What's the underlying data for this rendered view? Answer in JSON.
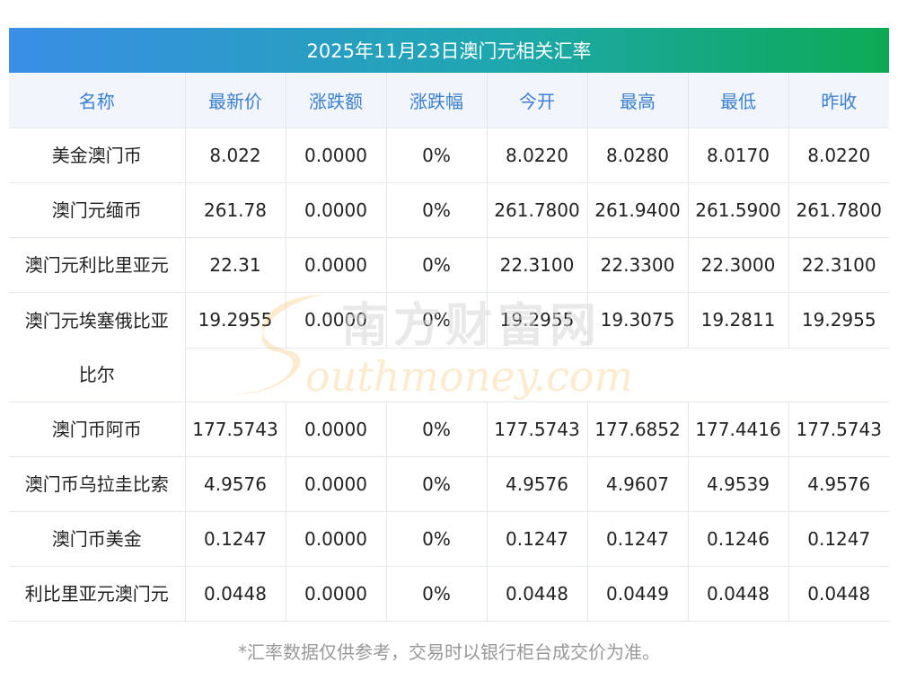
{
  "title": "2025年11月23日澳门元相关汇率",
  "columns": [
    "名称",
    "最新价",
    "涨跌额",
    "涨跌幅",
    "今开",
    "最高",
    "最低",
    "昨收"
  ],
  "rows": [
    [
      "美金澳门币",
      "8.022",
      "0.0000",
      "0%",
      "8.0220",
      "8.0280",
      "8.0170",
      "8.0220"
    ],
    [
      "澳门元缅币",
      "261.78",
      "0.0000",
      "0%",
      "261.7800",
      "261.9400",
      "261.5900",
      "261.7800"
    ],
    [
      "澳门元利比里亚元",
      "22.31",
      "0.0000",
      "0%",
      "22.3100",
      "22.3300",
      "22.3000",
      "22.3100"
    ],
    [
      "澳门元埃塞俄比亚比尔",
      "19.2955",
      "0.0000",
      "0%",
      "19.2955",
      "19.3075",
      "19.2811",
      "19.2955"
    ],
    [
      "澳门币阿币",
      "177.5743",
      "0.0000",
      "0%",
      "177.5743",
      "177.6852",
      "177.4416",
      "177.5743"
    ],
    [
      "澳门币乌拉圭比索",
      "4.9576",
      "0.0000",
      "0%",
      "4.9576",
      "4.9607",
      "4.9539",
      "4.9576"
    ],
    [
      "澳门币美金",
      "0.1247",
      "0.0000",
      "0%",
      "0.1247",
      "0.1247",
      "0.1246",
      "0.1247"
    ],
    [
      "利比里亚元澳门元",
      "0.0448",
      "0.0000",
      "0%",
      "0.0448",
      "0.0449",
      "0.0448",
      "0.0448"
    ]
  ],
  "name_lines": {
    "row3_line1": "澳门元埃塞俄比亚",
    "row3_line2": "比尔"
  },
  "watermark": {
    "cn": "南方财富网",
    "en": "outhmoney.com",
    "color": "#f5a623"
  },
  "note": "*汇率数据仅供参考，交易时以银行柜台成交价为准。",
  "colors": {
    "header_text": "#3a7fd0",
    "header_bg": "#f2f6fc",
    "title_grad_start": "#3a8ee6",
    "title_grad_end": "#0daa55"
  }
}
